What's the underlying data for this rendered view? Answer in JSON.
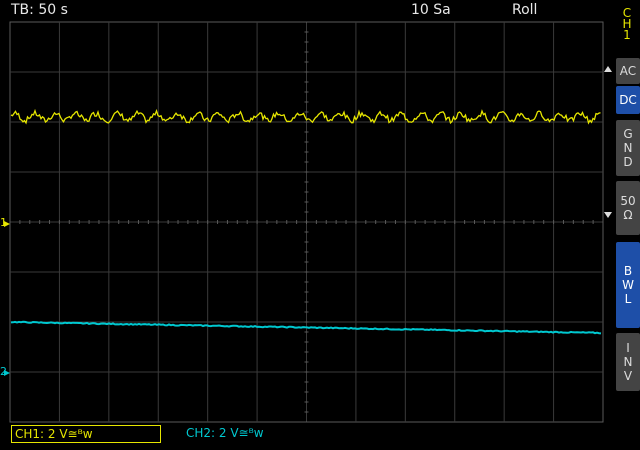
{
  "header": {
    "timebase": "TB: 50 s",
    "sample_rate": "10 Sa",
    "mode": "Roll"
  },
  "side_panel": {
    "channel_label": [
      "C",
      "H",
      "1"
    ],
    "buttons": [
      {
        "lines": [
          "AC"
        ],
        "active": false
      },
      {
        "lines": [
          "DC"
        ],
        "active": true
      },
      {
        "lines": [
          "G",
          "N",
          "D"
        ],
        "active": false
      },
      {
        "lines": [
          "50",
          "Ω"
        ],
        "active": false
      },
      {
        "lines": [
          "B",
          "W",
          "L"
        ],
        "active": true
      },
      {
        "lines": [
          "I",
          "N",
          "V"
        ],
        "active": false
      }
    ]
  },
  "markers": {
    "ch1_ref": "1",
    "ch2_ref": "2"
  },
  "footer": {
    "ch1": "CH1: 2 V≅ᴮw",
    "ch2": "CH2: 2 V≅ᴮw"
  },
  "colors": {
    "ch1": "#e6e600",
    "ch2": "#00c8d0",
    "grid": "#3a3a3a",
    "active_button": "#1e4fa8"
  },
  "traces": {
    "ch1_level_div": 2.1,
    "ch1_noise_div": 0.12,
    "ch2_start_div": -2.0,
    "ch2_end_div": -2.22
  }
}
